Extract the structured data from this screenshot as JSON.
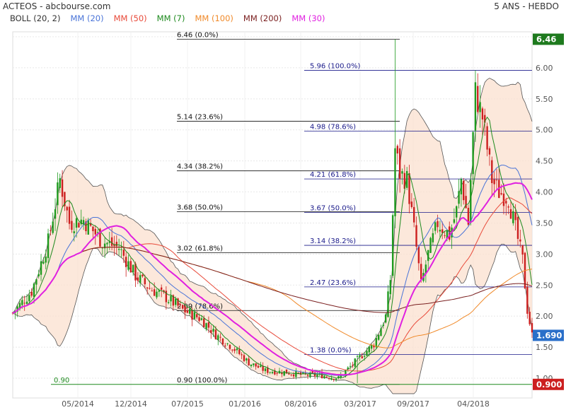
{
  "header": {
    "title": "ACTEOS - abcbourse.com",
    "period": "5 ANS - HEBDO"
  },
  "legend": [
    {
      "label": "BOLL (20, 2)",
      "color": "#333333"
    },
    {
      "label": "MM (20)",
      "color": "#4a74d8"
    },
    {
      "label": "MM (50)",
      "color": "#e84a3a"
    },
    {
      "label": "MM (7)",
      "color": "#1e8a1e"
    },
    {
      "label": "MM (100)",
      "color": "#f08a2a"
    },
    {
      "label": "MM (200)",
      "color": "#7a1f1f"
    },
    {
      "label": "MM (30)",
      "color": "#e020e0"
    }
  ],
  "chart_data": {
    "type": "candlestick",
    "ylim": [
      0.9,
      6.46
    ],
    "y_ticks": [
      "1.00",
      "1.50",
      "2.00",
      "2.50",
      "3.00",
      "3.50",
      "4.00",
      "4.50",
      "5.00",
      "5.50",
      "6.00",
      "6.50"
    ],
    "x_ticks": [
      "05/2014",
      "12/2014",
      "07/2015",
      "01/2016",
      "08/2016",
      "03/2017",
      "09/2017",
      "04/2018"
    ],
    "price_series": [
      [
        0,
        2.05
      ],
      [
        8,
        2.4
      ],
      [
        15,
        3.2
      ],
      [
        20,
        4.2
      ],
      [
        24,
        3.5
      ],
      [
        30,
        3.55
      ],
      [
        38,
        3.2
      ],
      [
        45,
        3.1
      ],
      [
        52,
        2.65
      ],
      [
        58,
        2.45
      ],
      [
        65,
        2.3
      ],
      [
        72,
        2.1
      ],
      [
        80,
        1.95
      ],
      [
        86,
        1.7
      ],
      [
        93,
        1.5
      ],
      [
        100,
        1.25
      ],
      [
        107,
        1.12
      ],
      [
        115,
        1.1
      ],
      [
        123,
        1.05
      ],
      [
        130,
        1.05
      ],
      [
        138,
        1.0
      ],
      [
        146,
        1.3
      ],
      [
        153,
        1.55
      ],
      [
        158,
        2.0
      ],
      [
        160,
        2.6
      ],
      [
        162,
        4.7
      ],
      [
        164,
        4.3
      ],
      [
        167,
        4.2
      ],
      [
        170,
        3.4
      ],
      [
        173,
        2.5
      ],
      [
        176,
        3.0
      ],
      [
        180,
        3.5
      ],
      [
        185,
        3.3
      ],
      [
        188,
        3.7
      ],
      [
        190,
        4.2
      ],
      [
        193,
        3.5
      ],
      [
        196,
        5.6
      ],
      [
        199,
        5.2
      ],
      [
        203,
        4.2
      ],
      [
        206,
        4.0
      ],
      [
        210,
        3.9
      ],
      [
        213,
        3.4
      ],
      [
        216,
        2.9
      ],
      [
        218,
        2.1
      ],
      [
        220,
        1.69
      ]
    ],
    "current_price": "1.690",
    "top_marker": "6.46",
    "bottom_marker": "0.900",
    "bottom_line_label": "0.90",
    "fib_left": [
      {
        "value": 6.46,
        "label": "6.46  (0.0%)"
      },
      {
        "value": 5.14,
        "label": "5.14  (23.6%)"
      },
      {
        "value": 4.34,
        "label": "4.34  (38.2%)"
      },
      {
        "value": 3.68,
        "label": "3.68  (50.0%)"
      },
      {
        "value": 3.02,
        "label": "3.02  (61.8%)"
      },
      {
        "value": 2.09,
        "label": "2.09  (78.6%)"
      },
      {
        "value": 0.9,
        "label": "0.90  (100.0%)"
      }
    ],
    "fib_right": [
      {
        "value": 5.96,
        "label": "5.96  (100.0%)"
      },
      {
        "value": 4.98,
        "label": "4.98  (78.6%)"
      },
      {
        "value": 4.21,
        "label": "4.21  (61.8%)"
      },
      {
        "value": 3.67,
        "label": "3.67  (50.0%)"
      },
      {
        "value": 3.14,
        "label": "3.14  (38.2%)"
      },
      {
        "value": 2.47,
        "label": "2.47  (23.6%)"
      },
      {
        "value": 1.38,
        "label": "1.38  (0.0%)"
      }
    ],
    "moving_averages": [
      {
        "name": "MM (20)",
        "period": 20,
        "color": "#4a74d8"
      },
      {
        "name": "MM (50)",
        "period": 50,
        "color": "#e84a3a"
      },
      {
        "name": "MM (7)",
        "period": 7,
        "color": "#1e8a1e"
      },
      {
        "name": "MM (100)",
        "period": 100,
        "color": "#f08a2a"
      },
      {
        "name": "MM (200)",
        "period": 200,
        "color": "#7a1f1f"
      },
      {
        "name": "MM (30)",
        "period": 30,
        "color": "#e020e0"
      }
    ],
    "bollinger": {
      "period": 20,
      "k": 2
    }
  }
}
